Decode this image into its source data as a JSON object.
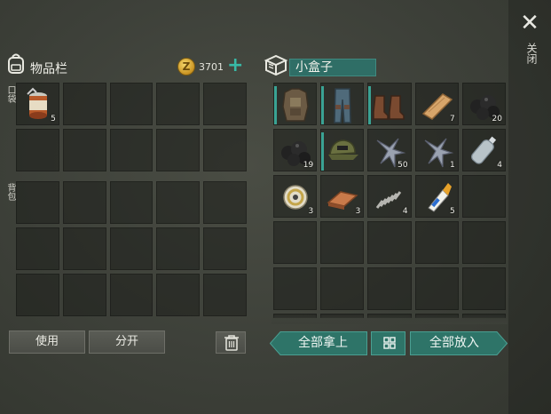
{
  "close": {
    "label": "关闭"
  },
  "inventory": {
    "title": "物品栏",
    "coins": "3701",
    "pockets_label": "口袋",
    "backpack_label": "背包",
    "pockets": [
      {
        "icon": "canned-food-icon",
        "count": "5"
      },
      {
        "icon": "",
        "count": ""
      },
      {
        "icon": "",
        "count": ""
      },
      {
        "icon": "",
        "count": ""
      },
      {
        "icon": "",
        "count": ""
      },
      {
        "icon": "",
        "count": ""
      },
      {
        "icon": "",
        "count": ""
      },
      {
        "icon": "",
        "count": ""
      },
      {
        "icon": "",
        "count": ""
      },
      {
        "icon": "",
        "count": ""
      }
    ],
    "backpack_slots": 15
  },
  "container": {
    "title": "小盒子",
    "items": [
      {
        "icon": "body-armor-icon",
        "count": "",
        "equip": true
      },
      {
        "icon": "pants-icon",
        "count": "",
        "equip": true
      },
      {
        "icon": "boots-icon",
        "count": "",
        "equip": true
      },
      {
        "icon": "wood-plank-icon",
        "count": "7",
        "equip": false
      },
      {
        "icon": "coal-icon",
        "count": "20",
        "equip": false
      },
      {
        "icon": "coal-icon",
        "count": "19",
        "equip": false
      },
      {
        "icon": "cap-icon",
        "count": "",
        "equip": true
      },
      {
        "icon": "metal-scrap-icon",
        "count": "50",
        "equip": false
      },
      {
        "icon": "metal-scrap-icon",
        "count": "1",
        "equip": false
      },
      {
        "icon": "plastic-bottle-icon",
        "count": "4",
        "equip": false
      },
      {
        "icon": "wire-spool-icon",
        "count": "3",
        "equip": false
      },
      {
        "icon": "copper-ingot-icon",
        "count": "3",
        "equip": false
      },
      {
        "icon": "spring-icon",
        "count": "4",
        "equip": false
      },
      {
        "icon": "glue-tube-icon",
        "count": "5",
        "equip": false
      },
      {
        "icon": "",
        "count": "",
        "equip": false
      }
    ],
    "empty_slots": 15
  },
  "buttons": {
    "use": "使用",
    "split": "分开",
    "take_all": "全部拿上",
    "put_all": "全部放入"
  },
  "colors": {
    "accent": "#2e7468",
    "plus": "#38b9a6",
    "coin": "#e0b540"
  }
}
